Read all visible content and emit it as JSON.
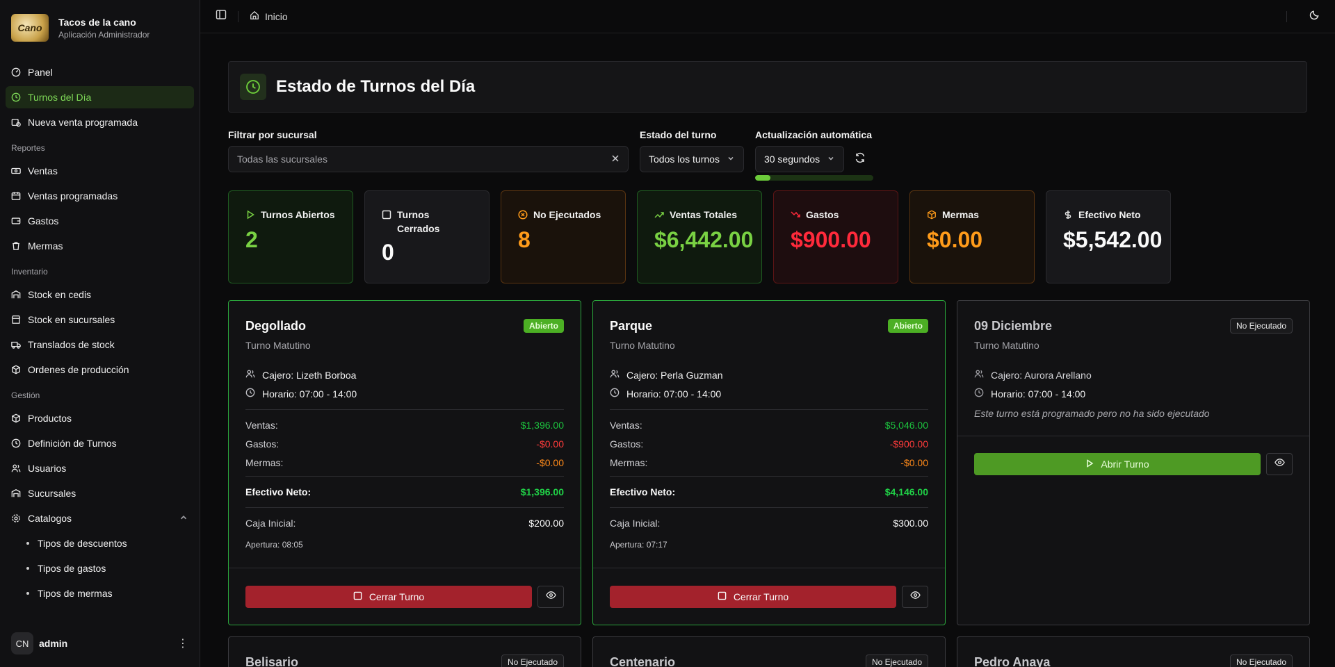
{
  "brand": {
    "name": "Tacos de la cano",
    "subtitle": "Aplicación Administrador",
    "logo_text": "Cano"
  },
  "nav": {
    "main": [
      {
        "label": "Panel",
        "icon": "gauge-icon"
      },
      {
        "label": "Turnos del Día",
        "icon": "clock-icon",
        "active": true
      },
      {
        "label": "Nueva venta programada",
        "icon": "calendar-clock-icon"
      }
    ],
    "reportes_label": "Reportes",
    "reportes": [
      {
        "label": "Ventas",
        "icon": "banknote-icon"
      },
      {
        "label": "Ventas programadas",
        "icon": "calendar-icon"
      },
      {
        "label": "Gastos",
        "icon": "wallet-icon"
      },
      {
        "label": "Mermas",
        "icon": "trash-icon"
      }
    ],
    "inventario_label": "Inventario",
    "inventario": [
      {
        "label": "Stock en cedis",
        "icon": "warehouse-icon"
      },
      {
        "label": "Stock en sucursales",
        "icon": "store-icon"
      },
      {
        "label": "Translados de stock",
        "icon": "truck-icon"
      },
      {
        "label": "Ordenes de producción",
        "icon": "package-icon"
      }
    ],
    "gestion_label": "Gestión",
    "gestion": [
      {
        "label": "Productos",
        "icon": "box-icon"
      },
      {
        "label": "Definición de Turnos",
        "icon": "clock-icon"
      },
      {
        "label": "Usuarios",
        "icon": "users-icon"
      },
      {
        "label": "Sucursales",
        "icon": "building-icon"
      },
      {
        "label": "Catalogos",
        "icon": "settings-icon"
      }
    ],
    "catalogos": [
      "Tipos de descuentos",
      "Tipos de gastos",
      "Tipos de mermas"
    ]
  },
  "user": {
    "initials": "CN",
    "name": "admin"
  },
  "topbar": {
    "breadcrumb": "Inicio"
  },
  "page": {
    "title": "Estado de Turnos del Día"
  },
  "filters": {
    "sucursal_label": "Filtrar por sucursal",
    "sucursal_placeholder": "Todas las sucursales",
    "estado_label": "Estado del turno",
    "estado_value": "Todos los turnos",
    "auto_label": "Actualización automática",
    "auto_value": "30 segundos",
    "auto_progress": 0.13
  },
  "stats": [
    {
      "label": "Turnos Abiertos",
      "value": "2",
      "tone": "green",
      "icon": "play-icon"
    },
    {
      "label": "Turnos Cerrados",
      "value": "0",
      "tone": "white",
      "icon": "square-icon"
    },
    {
      "label": "No Ejecutados",
      "value": "8",
      "tone": "orange",
      "icon": "x-circle-icon"
    },
    {
      "label": "Ventas Totales",
      "value": "$6,442.00",
      "tone": "green",
      "icon": "trending-up-icon"
    },
    {
      "label": "Gastos",
      "value": "$900.00",
      "tone": "red",
      "icon": "trending-down-icon"
    },
    {
      "label": "Mermas",
      "value": "$0.00",
      "tone": "orange",
      "icon": "package-icon"
    },
    {
      "label": "Efectivo Neto",
      "value": "$5,542.00",
      "tone": "white",
      "icon": "dollar-icon"
    }
  ],
  "labels": {
    "ventas": "Ventas:",
    "gastos": "Gastos:",
    "mermas": "Mermas:",
    "efectivo": "Efectivo Neto:",
    "caja": "Caja Inicial:",
    "cerrar": "Cerrar Turno",
    "abrir": "Abrir Turno"
  },
  "cards": [
    {
      "name": "Degollado",
      "badge": "Abierto",
      "shift": "Turno Matutino",
      "cajero": "Cajero: Lizeth Borboa",
      "horario": "Horario: 07:00 - 14:00",
      "ventas": "$1,396.00",
      "gastos": "-$0.00",
      "mermas": "-$0.00",
      "efectivo": "$1,396.00",
      "caja": "$200.00",
      "apertura": "Apertura: 08:05"
    },
    {
      "name": "Parque",
      "badge": "Abierto",
      "shift": "Turno Matutino",
      "cajero": "Cajero: Perla Guzman",
      "horario": "Horario: 07:00 - 14:00",
      "ventas": "$5,046.00",
      "gastos": "-$900.00",
      "mermas": "-$0.00",
      "efectivo": "$4,146.00",
      "caja": "$300.00",
      "apertura": "Apertura: 07:17"
    },
    {
      "name": "09 Diciembre",
      "badge": "No Ejecutado",
      "shift": "Turno Matutino",
      "cajero": "Cajero: Aurora Arellano",
      "horario": "Horario: 07:00 - 14:00",
      "note": "Este turno está programado pero no ha sido ejecutado"
    }
  ],
  "cards_row2": [
    {
      "name": "Belisario",
      "badge": "No Ejecutado"
    },
    {
      "name": "Centenario",
      "badge": "No Ejecutado"
    },
    {
      "name": "Pedro Anaya",
      "badge": "No Ejecutado"
    }
  ]
}
